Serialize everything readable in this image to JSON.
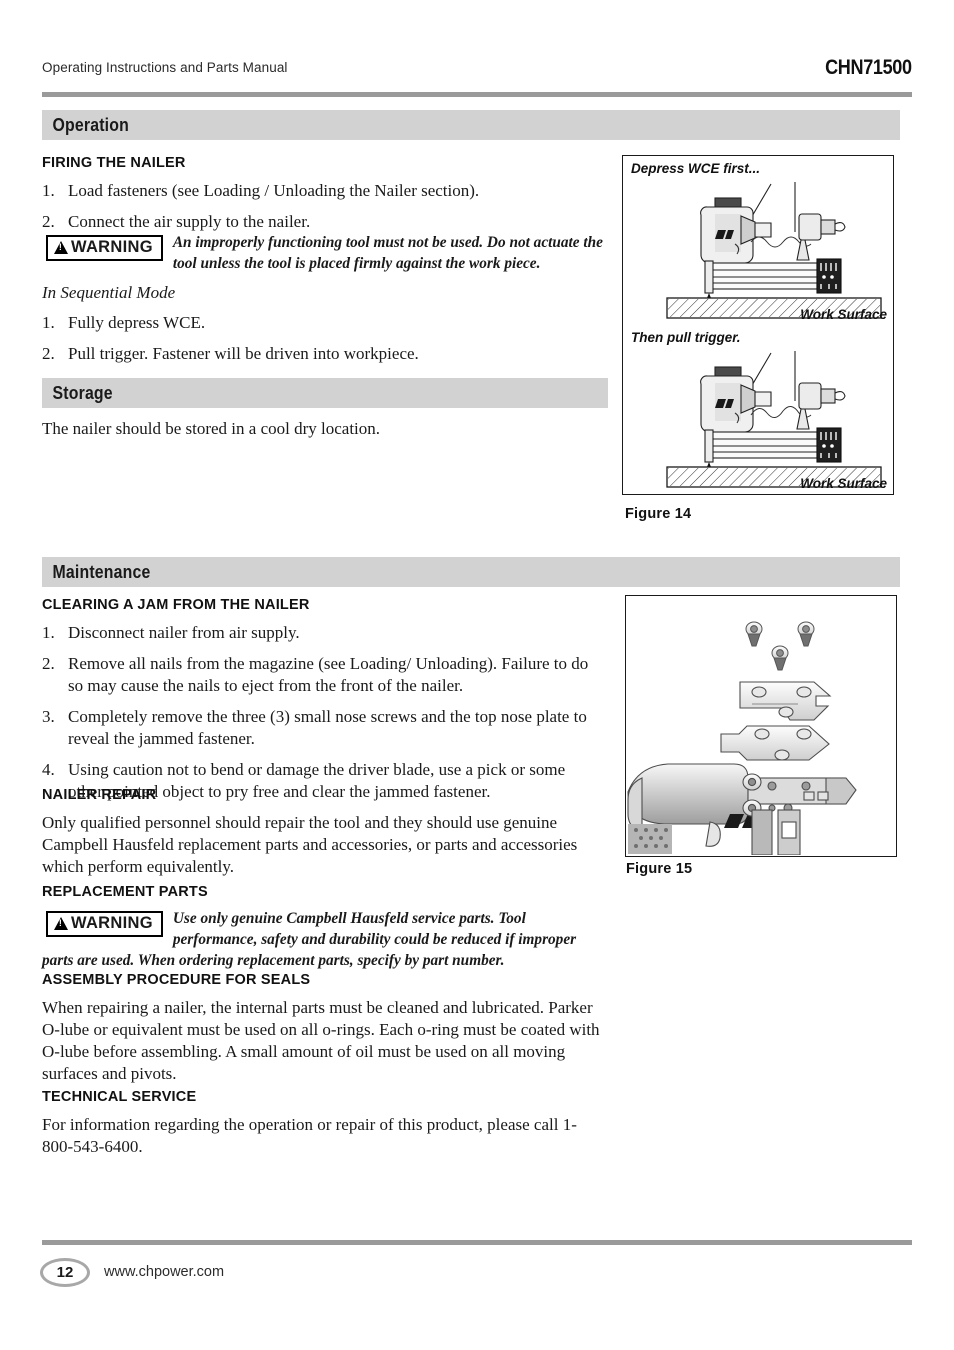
{
  "header": {
    "running_head": "Operating Instructions and Parts Manual",
    "model_number": "CHN71500"
  },
  "sections": {
    "operation": {
      "bar_title": "Operation",
      "firing": {
        "heading": "FIRING THE NAILER",
        "steps": [
          {
            "num": "1.",
            "text": "Load fasteners (see Loading / Unloading the Nailer section)."
          },
          {
            "num": "2.",
            "text": "Connect the air supply to the nailer."
          }
        ],
        "warning": {
          "badge": "WARNING",
          "text": "An improperly functioning tool must not be used. Do not actuate the tool unless the tool is placed firmly against the work piece."
        },
        "mode_lead": "In Sequential Mode",
        "mode_steps": [
          {
            "num": "1.",
            "text": "Fully depress WCE."
          },
          {
            "num": "2.",
            "text": "Pull trigger. Fastener will be driven into workpiece."
          }
        ]
      }
    },
    "storage": {
      "bar_title": "Storage",
      "text": "The nailer should be stored in a cool dry location."
    },
    "maintenance": {
      "bar_title": "Maintenance",
      "clearing_jam": {
        "heading": "CLEARING A JAM FROM THE NAILER",
        "steps": [
          {
            "num": "1.",
            "text": "Disconnect nailer from air supply."
          },
          {
            "num": "2.",
            "text": "Remove all nails from the magazine (see Loading/ Unloading). Failure to do so may cause the nails to eject from the front of the nailer."
          },
          {
            "num": "3.",
            "text": "Completely remove the three (3) small nose screws and the top nose plate to reveal the jammed fastener."
          },
          {
            "num": "4.",
            "text": "Using caution not to bend or damage the driver blade, use a pick or some other pointed object to pry free and clear the jammed fastener."
          }
        ]
      },
      "nailer_repair": {
        "heading": "NAILER REPAIR",
        "text": "Only qualified personnel should repair the tool and they should use genuine Campbell Hausfeld replacement parts and accessories, or parts and accessories which perform equivalently."
      },
      "replacement_parts": {
        "heading": "REPLACEMENT PARTS",
        "warning": {
          "badge": "WARNING",
          "text": "Use only genuine Campbell Hausfeld service parts. Tool performance, safety and durability could be reduced if improper parts are used. When ordering replacement parts, specify by part number."
        }
      },
      "assembly_seals": {
        "heading": "ASSEMBLY PROCEDURE FOR SEALS",
        "text": "When repairing a nailer, the internal parts must be cleaned and lubricated. Parker O-lube or equivalent must be used on all o-rings. Each o-ring must be coated with O-lube before assembling. A small amount of oil must be used on all moving surfaces and pivots."
      },
      "technical_service": {
        "heading": "TECHNICAL SERVICE",
        "text": "For information regarding the operation or repair of this product, please call 1-800-543-6400."
      }
    }
  },
  "figures": {
    "figure14": {
      "caption": "Figure 14",
      "panel_top_label": "Depress WCE first...",
      "panel_bottom_label": "Then pull trigger.",
      "work_surface_label": "Work Surface"
    },
    "figure15": {
      "caption": "Figure 15"
    }
  },
  "footer": {
    "page_number": "12",
    "url": "www.chpower.com"
  },
  "colors": {
    "section_bar": "#d2d2d2",
    "rule": "#9a9a9a",
    "text": "#1a1a1a"
  }
}
